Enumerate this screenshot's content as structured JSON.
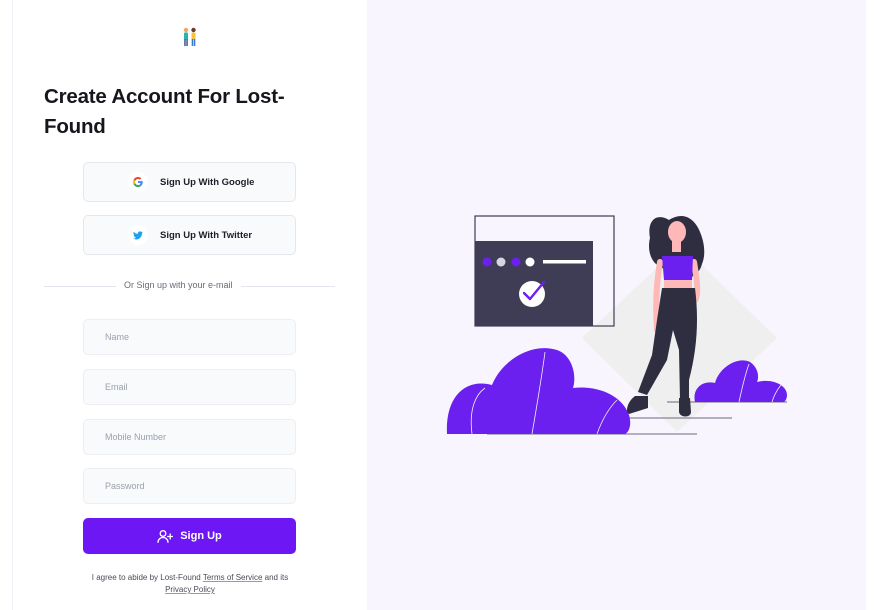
{
  "app": {
    "title": "Create Account For Lost-Found"
  },
  "social": {
    "google_label": "Sign Up With Google",
    "twitter_label": "Sign Up With Twitter"
  },
  "divider_text": "Or Sign up with your e-mail",
  "form": {
    "name": {
      "placeholder": "Name",
      "value": ""
    },
    "email": {
      "placeholder": "Email",
      "value": ""
    },
    "mobile": {
      "placeholder": "Mobile Number",
      "value": ""
    },
    "password": {
      "placeholder": "Password",
      "value": ""
    },
    "submit_label": "Sign Up"
  },
  "terms": {
    "prefix": "I agree to abide by Lost-Found",
    "tos_link": "Terms of Service",
    "middle": "and its",
    "privacy_link": "Privacy Policy"
  },
  "icons": {
    "logo": "people-logo-icon",
    "google": "google-icon",
    "twitter": "twitter-icon",
    "signup": "user-plus-icon",
    "illustration": "signup-illustration"
  },
  "colors": {
    "accent": "#6e17f5",
    "illustration_purple": "#6c20f0",
    "panel_bg": "#f8f5fe",
    "dark": "#3f3d56"
  }
}
